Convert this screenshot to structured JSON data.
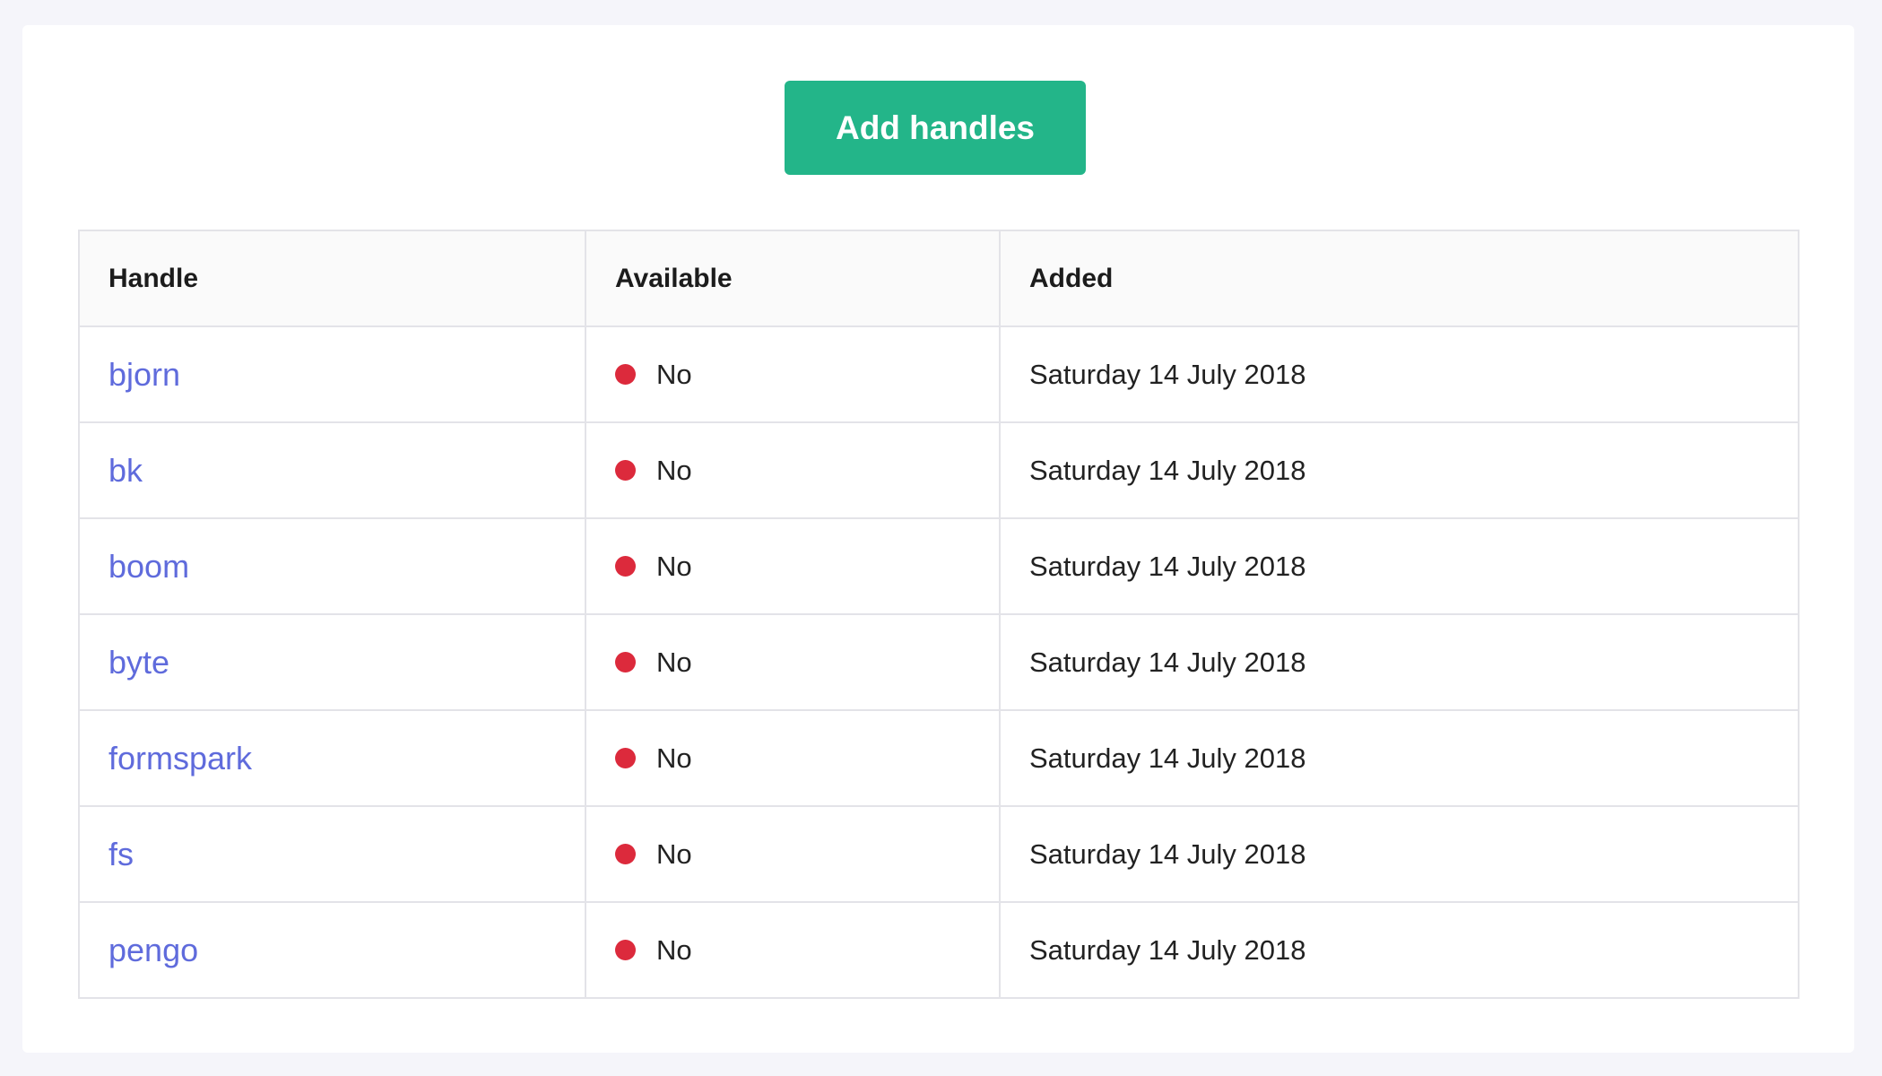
{
  "toolbar": {
    "add_label": "Add handles"
  },
  "table": {
    "headers": {
      "handle": "Handle",
      "available": "Available",
      "added": "Added"
    },
    "rows": [
      {
        "handle": "bjorn",
        "available": "No",
        "added": "Saturday 14 July 2018"
      },
      {
        "handle": "bk",
        "available": "No",
        "added": "Saturday 14 July 2018"
      },
      {
        "handle": "boom",
        "available": "No",
        "added": "Saturday 14 July 2018"
      },
      {
        "handle": "byte",
        "available": "No",
        "added": "Saturday 14 July 2018"
      },
      {
        "handle": "formspark",
        "available": "No",
        "added": "Saturday 14 July 2018"
      },
      {
        "handle": "fs",
        "available": "No",
        "added": "Saturday 14 July 2018"
      },
      {
        "handle": "pengo",
        "available": "No",
        "added": "Saturday 14 July 2018"
      }
    ]
  },
  "colors": {
    "accent_button": "#23b589",
    "link": "#5f6bdc",
    "status_unavailable": "#dc2a3c",
    "background": "#f5f5fa"
  },
  "icons": {
    "status": "status-dot-icon"
  }
}
